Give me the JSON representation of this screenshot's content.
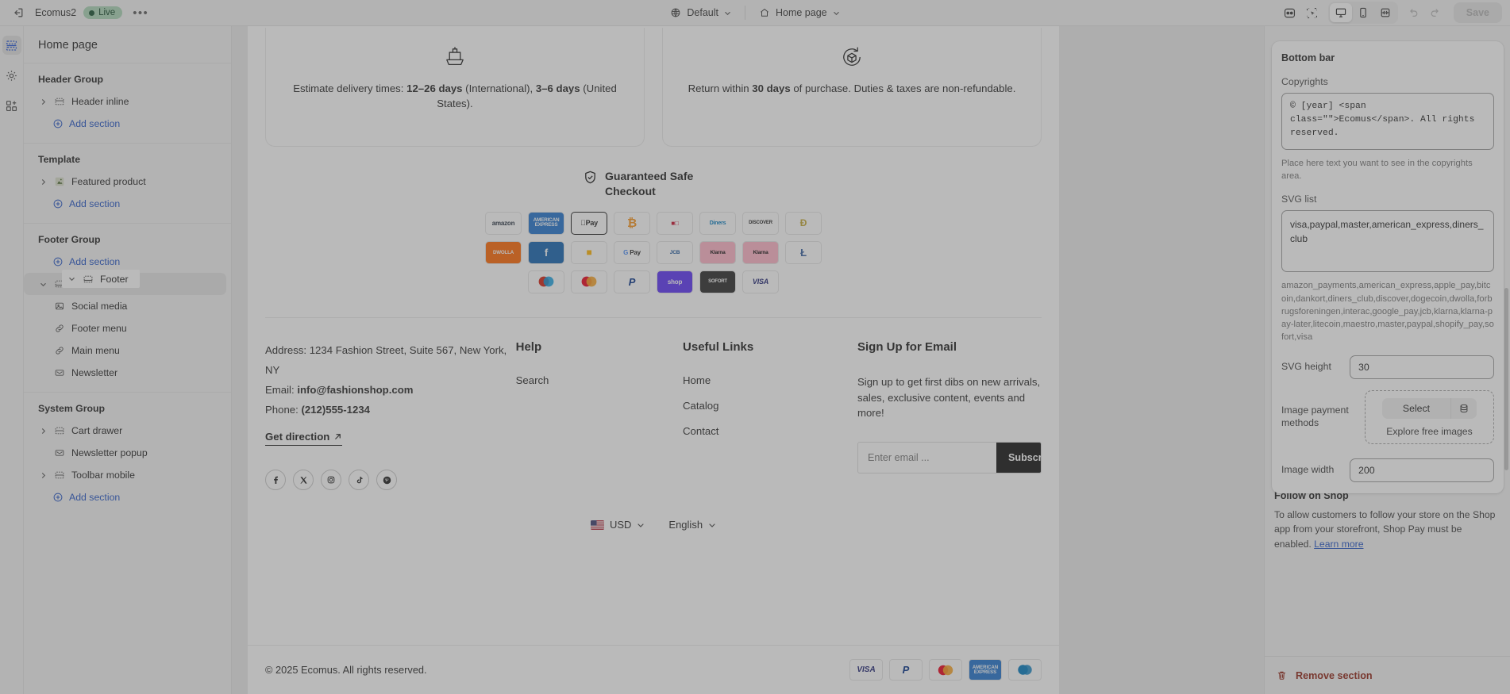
{
  "topbar": {
    "back_icon": "exit-icon",
    "store_name": "Ecomus2",
    "live_label": "Live",
    "more_label": "•••",
    "theme_chip": {
      "icon": "globe-icon",
      "label": "Default"
    },
    "page_chip": {
      "icon": "home-icon",
      "label": "Home page"
    },
    "right_icons": [
      {
        "name": "inspector-icon"
      },
      {
        "name": "select-pointer-icon"
      },
      {
        "name": "desktop-icon",
        "active": true
      },
      {
        "name": "mobile-icon",
        "active": false
      },
      {
        "name": "fullscreen-icon",
        "active": false
      }
    ],
    "undo_label": "undo-icon",
    "redo_label": "redo-icon",
    "save_label": "Save"
  },
  "rail": {
    "items": [
      {
        "name": "sections-icon",
        "active": true
      },
      {
        "name": "gear-icon",
        "active": false
      },
      {
        "name": "apps-icon",
        "active": false
      }
    ]
  },
  "sidebar": {
    "page_title": "Home page",
    "add_section_label": "Add section",
    "groups": [
      {
        "title": "Header Group",
        "rows": [
          {
            "label": "Header inline",
            "icon": "section-icon",
            "caret": "right"
          }
        ]
      },
      {
        "title": "Template",
        "rows": [
          {
            "label": "Featured product",
            "icon": "product-icon",
            "caret": "right"
          }
        ]
      },
      {
        "title": "Footer Group",
        "rows": [
          {
            "label": "Footer",
            "icon": "footer-icon",
            "caret": "down",
            "selected": true
          },
          {
            "label": "Social media",
            "icon": "image-icon",
            "caret": "none",
            "sub": true
          },
          {
            "label": "Footer menu",
            "icon": "link-icon",
            "caret": "none",
            "sub": true
          },
          {
            "label": "Main menu",
            "icon": "link-icon",
            "caret": "none",
            "sub": true
          },
          {
            "label": "Newsletter",
            "icon": "mail-icon",
            "caret": "none",
            "sub": true
          }
        ]
      },
      {
        "title": "System Group",
        "rows": [
          {
            "label": "Cart drawer",
            "icon": "section-icon",
            "caret": "right"
          },
          {
            "label": "Newsletter popup",
            "icon": "mail-icon",
            "caret": "none"
          },
          {
            "label": "Toolbar mobile",
            "icon": "section-icon",
            "caret": "right"
          }
        ]
      }
    ]
  },
  "preview": {
    "policies": [
      {
        "icon": "ship-icon",
        "lines": [
          "Estimate delivery times: ",
          "12–26 days",
          " (International), ",
          "3–6 days",
          " (United States)."
        ]
      },
      {
        "icon": "return-icon",
        "lines": [
          "Return within ",
          "30 days",
          " of purchase. Duties & taxes are non-refundable."
        ]
      }
    ],
    "safe_checkout": {
      "icon": "shield-icon",
      "title": "Guaranteed Safe Checkout"
    },
    "payment_rows": [
      [
        "amazon",
        "AMEX",
        "Apple Pay",
        "bitcoin",
        "dankort",
        "Diners",
        "DISCOVER",
        "dogecoin"
      ],
      [
        "DWOLLA",
        "forbrugs",
        "interac",
        "G Pay",
        "JCB",
        "Klarna",
        "Klarna",
        "litecoin"
      ],
      [
        "maestro",
        "mastercard",
        "PayPal",
        "shop",
        "SOFORT",
        "VISA"
      ]
    ],
    "selected_payment": "Apple Pay",
    "columns": {
      "contact": {
        "address_label": "Address: 1234 Fashion Street, Suite 567, New York, NY",
        "email_label": "Email: ",
        "email_value": "info@fashionshop.com",
        "phone_label": "Phone: ",
        "phone_value": "(212)555-1234",
        "get_direction": "Get direction",
        "socials": [
          "facebook-icon",
          "x-icon",
          "instagram-icon",
          "tiktok-icon",
          "pinterest-icon"
        ]
      },
      "help": {
        "title": "Help",
        "links": [
          "Search"
        ]
      },
      "useful": {
        "title": "Useful Links",
        "links": [
          "Home",
          "Catalog",
          "Contact"
        ]
      },
      "signup": {
        "title": "Sign Up for Email",
        "description": "Sign up to get first dibs on new arrivals, sales, exclusive content, events and more!",
        "placeholder": "Enter email ...",
        "button": "Subscribe"
      }
    },
    "locale": {
      "currency": "USD",
      "language": "English"
    },
    "bottom": {
      "copyright": "© 2025 Ecomus. All rights reserved.",
      "payments": [
        "VISA",
        "PayPal",
        "mastercard",
        "AMEX",
        "Diners"
      ]
    }
  },
  "right_panel": {
    "title": "Bottom bar",
    "copyrights": {
      "label": "Copyrights",
      "value": "© [year] <span class=\"\">Ecomus</span>. All rights reserved.",
      "help": "Place here text you want to see in the copyrights area."
    },
    "svg_list": {
      "label": "SVG list",
      "value": "visa,paypal,master,american_express,diners_club",
      "help": "amazon_payments,american_express,apple_pay,bitcoin,dankort,diners_club,discover,dogecoin,dwolla,forbrugsforeningen,interac,google_pay,jcb,klarna,klarna-pay-later,litecoin,maestro,master,paypal,shopify_pay,sofort,visa"
    },
    "svg_height": {
      "label": "SVG height",
      "value": "30"
    },
    "image_payment_methods": {
      "label": "Image payment methods",
      "select_label": "Select",
      "browse_icon": "library-icon",
      "explore_label": "Explore free images"
    },
    "image_width": {
      "label": "Image width",
      "value": "200"
    },
    "follow_on_shop": {
      "title": "Follow on Shop",
      "text": "To allow customers to follow your store on the Shop app from your storefront, Shop Pay must be enabled. ",
      "link": "Learn more"
    },
    "remove_section": {
      "icon": "trash-icon",
      "label": "Remove section"
    }
  },
  "colors": {
    "accent_blue": "#1f52c4",
    "live_green": "#a9d5b5",
    "danger_red": "#8e1f11",
    "chrome_bg": "#f3f3f3"
  }
}
